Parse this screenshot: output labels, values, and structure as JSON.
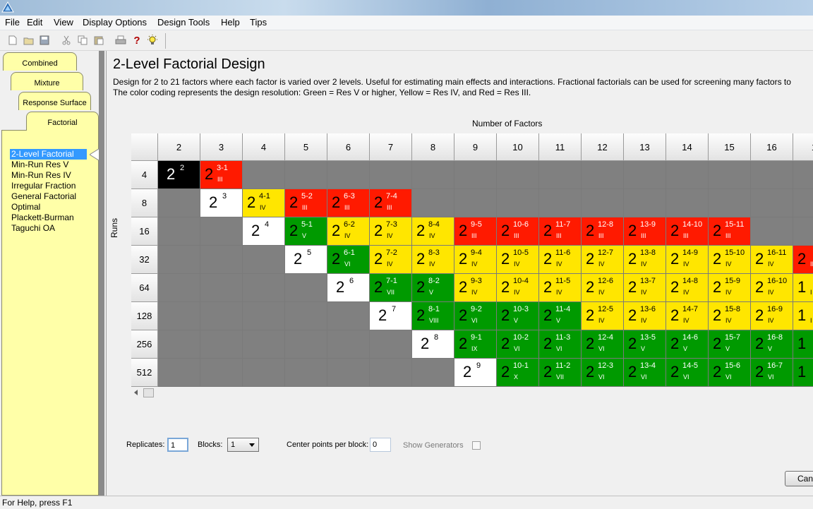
{
  "menu": [
    "File",
    "Edit",
    "View",
    "Display Options",
    "Design Tools",
    "Help",
    "Tips"
  ],
  "toolbar": {
    "icons": [
      "new-icon",
      "open-icon",
      "save-icon",
      "cut-icon",
      "copy-icon",
      "paste-icon",
      "print-icon",
      "help-icon",
      "tip-icon"
    ],
    "help_glyph": "?"
  },
  "tabs": [
    "Combined",
    "Mixture",
    "Response Surface",
    "Factorial"
  ],
  "design_list": [
    "2-Level Factorial",
    "Min-Run Res V",
    "Min-Run Res IV",
    "Irregular Fraction",
    "General Factorial",
    "Optimal",
    "Plackett-Burman",
    "Taguchi OA"
  ],
  "selected_design": "2-Level Factorial",
  "page": {
    "title": "2-Level Factorial Design",
    "desc_line1": "Design for 2 to 21 factors where each factor is varied over 2 levels.  Useful for estimating main effects and interactions.  Fractional factorials can be used for screening many factors to",
    "desc_line2": "The color coding represents the design resolution: Green = Res V or higher, Yellow = Res IV, and Red = Res III."
  },
  "grid": {
    "factors_title": "Number of Factors",
    "runs_title": "Runs",
    "columns": [
      "2",
      "3",
      "4",
      "5",
      "6",
      "7",
      "8",
      "9",
      "10",
      "11",
      "12",
      "13",
      "14",
      "15",
      "16",
      "1"
    ],
    "rows": [
      "4",
      "8",
      "16",
      "32",
      "64",
      "128",
      "256",
      "512"
    ],
    "colors": {
      "black": "#000000",
      "white": "#ffffff",
      "red": "#ff1a00",
      "yellow": "#ffe600",
      "green": "#009a00",
      "gray": "#808080"
    },
    "cells": [
      [
        {
          "c": "black",
          "b": "2",
          "e": "2",
          "r": ""
        },
        {
          "c": "red",
          "b": "2",
          "e": "3-1",
          "r": "III"
        },
        {
          "c": "gray"
        },
        {
          "c": "gray"
        },
        {
          "c": "gray"
        },
        {
          "c": "gray"
        },
        {
          "c": "gray"
        },
        {
          "c": "gray"
        },
        {
          "c": "gray"
        },
        {
          "c": "gray"
        },
        {
          "c": "gray"
        },
        {
          "c": "gray"
        },
        {
          "c": "gray"
        },
        {
          "c": "gray"
        },
        {
          "c": "gray"
        },
        {
          "c": "gray"
        }
      ],
      [
        {
          "c": "gray"
        },
        {
          "c": "white",
          "b": "2",
          "e": "3",
          "r": ""
        },
        {
          "c": "yellow",
          "b": "2",
          "e": "4-1",
          "r": "IV"
        },
        {
          "c": "red",
          "b": "2",
          "e": "5-2",
          "r": "III"
        },
        {
          "c": "red",
          "b": "2",
          "e": "6-3",
          "r": "III"
        },
        {
          "c": "red",
          "b": "2",
          "e": "7-4",
          "r": "III"
        },
        {
          "c": "gray"
        },
        {
          "c": "gray"
        },
        {
          "c": "gray"
        },
        {
          "c": "gray"
        },
        {
          "c": "gray"
        },
        {
          "c": "gray"
        },
        {
          "c": "gray"
        },
        {
          "c": "gray"
        },
        {
          "c": "gray"
        },
        {
          "c": "gray"
        }
      ],
      [
        {
          "c": "gray"
        },
        {
          "c": "gray"
        },
        {
          "c": "white",
          "b": "2",
          "e": "4",
          "r": ""
        },
        {
          "c": "green",
          "b": "2",
          "e": "5-1",
          "r": "V"
        },
        {
          "c": "yellow",
          "b": "2",
          "e": "6-2",
          "r": "IV"
        },
        {
          "c": "yellow",
          "b": "2",
          "e": "7-3",
          "r": "IV"
        },
        {
          "c": "yellow",
          "b": "2",
          "e": "8-4",
          "r": "IV"
        },
        {
          "c": "red",
          "b": "2",
          "e": "9-5",
          "r": "III"
        },
        {
          "c": "red",
          "b": "2",
          "e": "10-6",
          "r": "III"
        },
        {
          "c": "red",
          "b": "2",
          "e": "11-7",
          "r": "III"
        },
        {
          "c": "red",
          "b": "2",
          "e": "12-8",
          "r": "III"
        },
        {
          "c": "red",
          "b": "2",
          "e": "13-9",
          "r": "III"
        },
        {
          "c": "red",
          "b": "2",
          "e": "14-10",
          "r": "III"
        },
        {
          "c": "red",
          "b": "2",
          "e": "15-11",
          "r": "III"
        },
        {
          "c": "gray"
        },
        {
          "c": "gray"
        }
      ],
      [
        {
          "c": "gray"
        },
        {
          "c": "gray"
        },
        {
          "c": "gray"
        },
        {
          "c": "white",
          "b": "2",
          "e": "5",
          "r": ""
        },
        {
          "c": "green",
          "b": "2",
          "e": "6-1",
          "r": "VI"
        },
        {
          "c": "yellow",
          "b": "2",
          "e": "7-2",
          "r": "IV"
        },
        {
          "c": "yellow",
          "b": "2",
          "e": "8-3",
          "r": "IV"
        },
        {
          "c": "yellow",
          "b": "2",
          "e": "9-4",
          "r": "IV"
        },
        {
          "c": "yellow",
          "b": "2",
          "e": "10-5",
          "r": "IV"
        },
        {
          "c": "yellow",
          "b": "2",
          "e": "11-6",
          "r": "IV"
        },
        {
          "c": "yellow",
          "b": "2",
          "e": "12-7",
          "r": "IV"
        },
        {
          "c": "yellow",
          "b": "2",
          "e": "13-8",
          "r": "IV"
        },
        {
          "c": "yellow",
          "b": "2",
          "e": "14-9",
          "r": "IV"
        },
        {
          "c": "yellow",
          "b": "2",
          "e": "15-10",
          "r": "IV"
        },
        {
          "c": "yellow",
          "b": "2",
          "e": "16-11",
          "r": "IV"
        },
        {
          "c": "red",
          "b": "2",
          "e": "",
          "r": "II"
        }
      ],
      [
        {
          "c": "gray"
        },
        {
          "c": "gray"
        },
        {
          "c": "gray"
        },
        {
          "c": "gray"
        },
        {
          "c": "white",
          "b": "2",
          "e": "6",
          "r": ""
        },
        {
          "c": "green",
          "b": "2",
          "e": "7-1",
          "r": "VII"
        },
        {
          "c": "green",
          "b": "2",
          "e": "8-2",
          "r": "V"
        },
        {
          "c": "yellow",
          "b": "2",
          "e": "9-3",
          "r": "IV"
        },
        {
          "c": "yellow",
          "b": "2",
          "e": "10-4",
          "r": "IV"
        },
        {
          "c": "yellow",
          "b": "2",
          "e": "11-5",
          "r": "IV"
        },
        {
          "c": "yellow",
          "b": "2",
          "e": "12-6",
          "r": "IV"
        },
        {
          "c": "yellow",
          "b": "2",
          "e": "13-7",
          "r": "IV"
        },
        {
          "c": "yellow",
          "b": "2",
          "e": "14-8",
          "r": "IV"
        },
        {
          "c": "yellow",
          "b": "2",
          "e": "15-9",
          "r": "IV"
        },
        {
          "c": "yellow",
          "b": "2",
          "e": "16-10",
          "r": "IV"
        },
        {
          "c": "yellow",
          "b": "1",
          "e": "",
          "r": "I"
        }
      ],
      [
        {
          "c": "gray"
        },
        {
          "c": "gray"
        },
        {
          "c": "gray"
        },
        {
          "c": "gray"
        },
        {
          "c": "gray"
        },
        {
          "c": "white",
          "b": "2",
          "e": "7",
          "r": ""
        },
        {
          "c": "green",
          "b": "2",
          "e": "8-1",
          "r": "VIII"
        },
        {
          "c": "green",
          "b": "2",
          "e": "9-2",
          "r": "VI"
        },
        {
          "c": "green",
          "b": "2",
          "e": "10-3",
          "r": "V"
        },
        {
          "c": "green",
          "b": "2",
          "e": "11-4",
          "r": "V"
        },
        {
          "c": "yellow",
          "b": "2",
          "e": "12-5",
          "r": "IV"
        },
        {
          "c": "yellow",
          "b": "2",
          "e": "13-6",
          "r": "IV"
        },
        {
          "c": "yellow",
          "b": "2",
          "e": "14-7",
          "r": "IV"
        },
        {
          "c": "yellow",
          "b": "2",
          "e": "15-8",
          "r": "IV"
        },
        {
          "c": "yellow",
          "b": "2",
          "e": "16-9",
          "r": "IV"
        },
        {
          "c": "yellow",
          "b": "1",
          "e": "",
          "r": "I"
        }
      ],
      [
        {
          "c": "gray"
        },
        {
          "c": "gray"
        },
        {
          "c": "gray"
        },
        {
          "c": "gray"
        },
        {
          "c": "gray"
        },
        {
          "c": "gray"
        },
        {
          "c": "white",
          "b": "2",
          "e": "8",
          "r": ""
        },
        {
          "c": "green",
          "b": "2",
          "e": "9-1",
          "r": "IX"
        },
        {
          "c": "green",
          "b": "2",
          "e": "10-2",
          "r": "VI"
        },
        {
          "c": "green",
          "b": "2",
          "e": "11-3",
          "r": "VI"
        },
        {
          "c": "green",
          "b": "2",
          "e": "12-4",
          "r": "VI"
        },
        {
          "c": "green",
          "b": "2",
          "e": "13-5",
          "r": "V"
        },
        {
          "c": "green",
          "b": "2",
          "e": "14-6",
          "r": "V"
        },
        {
          "c": "green",
          "b": "2",
          "e": "15-7",
          "r": "V"
        },
        {
          "c": "green",
          "b": "2",
          "e": "16-8",
          "r": "V"
        },
        {
          "c": "green",
          "b": "1",
          "e": "",
          "r": ""
        }
      ],
      [
        {
          "c": "gray"
        },
        {
          "c": "gray"
        },
        {
          "c": "gray"
        },
        {
          "c": "gray"
        },
        {
          "c": "gray"
        },
        {
          "c": "gray"
        },
        {
          "c": "gray"
        },
        {
          "c": "white",
          "b": "2",
          "e": "9",
          "r": ""
        },
        {
          "c": "green",
          "b": "2",
          "e": "10-1",
          "r": "X"
        },
        {
          "c": "green",
          "b": "2",
          "e": "11-2",
          "r": "VII"
        },
        {
          "c": "green",
          "b": "2",
          "e": "12-3",
          "r": "VI"
        },
        {
          "c": "green",
          "b": "2",
          "e": "13-4",
          "r": "VI"
        },
        {
          "c": "green",
          "b": "2",
          "e": "14-5",
          "r": "VI"
        },
        {
          "c": "green",
          "b": "2",
          "e": "15-6",
          "r": "VI"
        },
        {
          "c": "green",
          "b": "2",
          "e": "16-7",
          "r": "VI"
        },
        {
          "c": "green",
          "b": "1",
          "e": "",
          "r": ""
        }
      ]
    ]
  },
  "controls": {
    "replicates_label": "Replicates:",
    "replicates_value": "1",
    "blocks_label": "Blocks:",
    "blocks_value": "1",
    "center_label": "Center points per block:",
    "center_value": "0",
    "generators_label": "Show Generators",
    "show_generators": false,
    "cancel_label": "Can"
  },
  "status": "For Help, press F1"
}
